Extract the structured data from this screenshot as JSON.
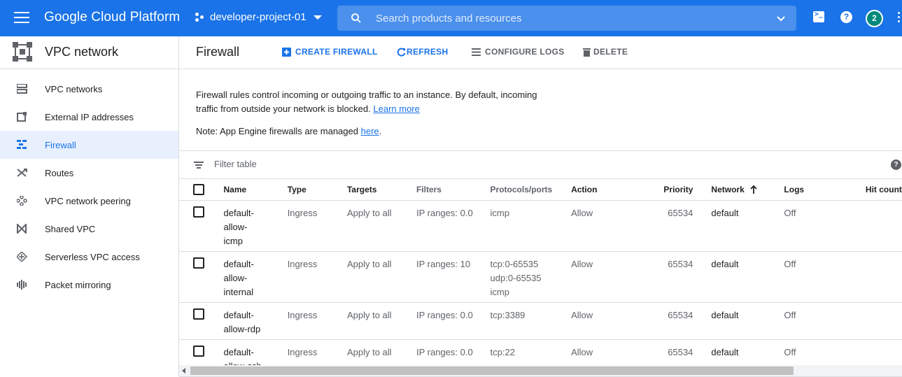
{
  "header": {
    "brand": "Google Cloud Platform",
    "project": "developer-project-01",
    "search_placeholder": "Search products and resources",
    "avatar_text": "2",
    "colors": {
      "bar": "#1a73e8",
      "avatar": "#00897b"
    }
  },
  "sidebar": {
    "title": "VPC network",
    "items": [
      {
        "label": "VPC networks",
        "icon": "vpc-networks-icon"
      },
      {
        "label": "External IP addresses",
        "icon": "external-ip-icon"
      },
      {
        "label": "Firewall",
        "icon": "firewall-icon",
        "active": true
      },
      {
        "label": "Routes",
        "icon": "routes-icon"
      },
      {
        "label": "VPC network peering",
        "icon": "peering-icon"
      },
      {
        "label": "Shared VPC",
        "icon": "shared-vpc-icon"
      },
      {
        "label": "Serverless VPC access",
        "icon": "serverless-icon"
      },
      {
        "label": "Packet mirroring",
        "icon": "packet-mirroring-icon"
      }
    ]
  },
  "main": {
    "title": "Firewall",
    "actions": {
      "create": "CREATE FIREWALL",
      "refresh": "REFRESH",
      "configure_logs": "CONFIGURE LOGS",
      "delete": "DELETE"
    },
    "info_text": "Firewall rules control incoming or outgoing traffic to an instance. By default, incoming traffic from outside your network is blocked.",
    "info_link": "Learn more",
    "note_text": "Note: App Engine firewalls are managed",
    "note_link": "here",
    "note_end": ".",
    "filter_placeholder": "Filter table"
  },
  "table": {
    "columns": {
      "name": "Name",
      "type": "Type",
      "targets": "Targets",
      "filters": "Filters",
      "protocols": "Protocols/ports",
      "action": "Action",
      "priority": "Priority",
      "network": "Network",
      "logs": "Logs",
      "hit_count": "Hit count"
    },
    "rows": [
      {
        "name": [
          "default-",
          "allow-",
          "icmp"
        ],
        "type": "Ingress",
        "targets": "Apply to all",
        "filters": "IP ranges: 0.0",
        "protocols": [
          "icmp"
        ],
        "action": "Allow",
        "priority": "65534",
        "network": "default",
        "logs": "Off"
      },
      {
        "name": [
          "default-",
          "allow-",
          "internal"
        ],
        "type": "Ingress",
        "targets": "Apply to all",
        "filters": "IP ranges: 10",
        "protocols": [
          "tcp:0-65535",
          "udp:0-65535",
          "icmp"
        ],
        "action": "Allow",
        "priority": "65534",
        "network": "default",
        "logs": "Off"
      },
      {
        "name": [
          "default-",
          "allow-rdp"
        ],
        "type": "Ingress",
        "targets": "Apply to all",
        "filters": "IP ranges: 0.0",
        "protocols": [
          "tcp:3389"
        ],
        "action": "Allow",
        "priority": "65534",
        "network": "default",
        "logs": "Off"
      },
      {
        "name": [
          "default-",
          "allow-ssh"
        ],
        "type": "Ingress",
        "targets": "Apply to all",
        "filters": "IP ranges: 0.0",
        "protocols": [
          "tcp:22"
        ],
        "action": "Allow",
        "priority": "65534",
        "network": "default",
        "logs": "Off"
      }
    ]
  }
}
